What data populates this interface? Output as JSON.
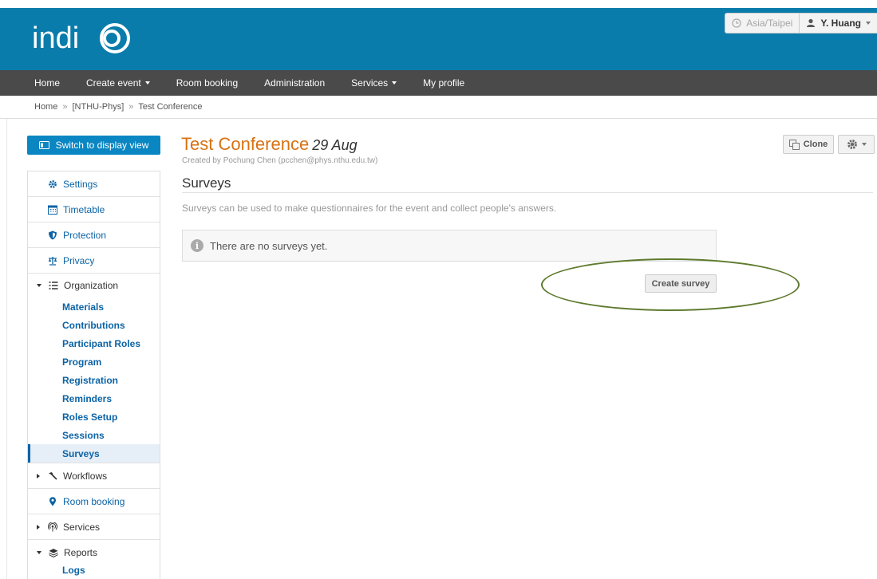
{
  "header": {
    "logo_text": "indico",
    "timezone": "Asia/Taipei",
    "user": "Y. Huang"
  },
  "nav": {
    "items": [
      {
        "label": "Home",
        "has_caret": false
      },
      {
        "label": "Create event",
        "has_caret": true
      },
      {
        "label": "Room booking",
        "has_caret": false
      },
      {
        "label": "Administration",
        "has_caret": false
      },
      {
        "label": "Services",
        "has_caret": true
      },
      {
        "label": "My profile",
        "has_caret": false
      }
    ]
  },
  "breadcrumb": [
    "Home",
    "[NTHU-Phys]",
    "Test Conference"
  ],
  "breadcrumb_sep": "»",
  "sidebar": {
    "switch_label": "Switch to display view",
    "settings": "Settings",
    "timetable": "Timetable",
    "protection": "Protection",
    "privacy": "Privacy",
    "organization": "Organization",
    "organization_items": [
      "Materials",
      "Contributions",
      "Participant Roles",
      "Program",
      "Registration",
      "Reminders",
      "Roles Setup",
      "Sessions",
      "Surveys"
    ],
    "active_item": "Surveys",
    "workflows": "Workflows",
    "room_booking": "Room booking",
    "services": "Services",
    "reports": "Reports",
    "reports_items": [
      "Logs"
    ]
  },
  "event": {
    "title": "Test Conference",
    "date": "29 Aug",
    "creator": "Created by Pochung Chen (pcchen@phys.nthu.edu.tw)"
  },
  "toolbar": {
    "clone_label": "Clone"
  },
  "main": {
    "section_title": "Surveys",
    "description": "Surveys can be used to make questionnaires for the event and collect people's answers.",
    "empty_message": "There are no surveys yet.",
    "create_label": "Create survey"
  },
  "colors": {
    "header_bg": "#0a7cab",
    "nav_bg": "#4a4a4a",
    "title": "#d87211",
    "link": "#0b63a5",
    "annotation": "#5e7a2e"
  }
}
